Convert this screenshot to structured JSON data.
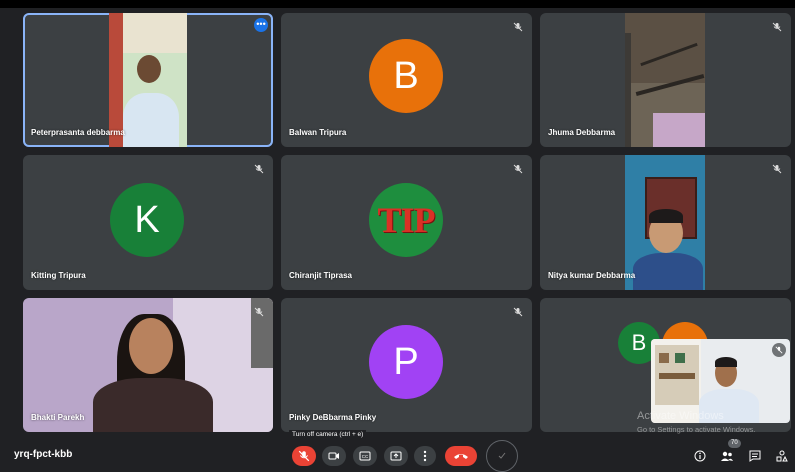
{
  "participants": [
    {
      "name": "Peterprasanta debbarma",
      "type": "video",
      "active": true
    },
    {
      "name": "Balwan Tripura",
      "type": "avatar",
      "initial": "B",
      "color": "#e8710a"
    },
    {
      "name": "Jhuma Debbarma",
      "type": "video"
    },
    {
      "name": "Kitting Tripura",
      "type": "avatar",
      "initial": "K",
      "color": "#188038"
    },
    {
      "name": "Chiranjit Tiprasa",
      "type": "logo",
      "logo_text": "TIP"
    },
    {
      "name": "Nitya kumar Debbarma",
      "type": "video"
    },
    {
      "name": "Bhakti Parekh",
      "type": "video"
    },
    {
      "name": "Pinky DeBbarma Pinky",
      "type": "avatar",
      "initial": "P",
      "color": "#a142f4"
    },
    {
      "name": "",
      "type": "grouped",
      "initials": [
        "B"
      ]
    }
  ],
  "self_view": {
    "initial_behind": "B"
  },
  "meeting": {
    "code": "yrq-fpct-kbb"
  },
  "tooltip": "Turn off camera (ctrl + e)",
  "people_count": "70",
  "watermark": {
    "line1": "Activate Windows",
    "line2": "Go to Settings to activate Windows."
  },
  "colors": {
    "accent": "#1a73e8",
    "danger": "#ea4335",
    "tile": "#3c4043",
    "bg": "#202124"
  }
}
